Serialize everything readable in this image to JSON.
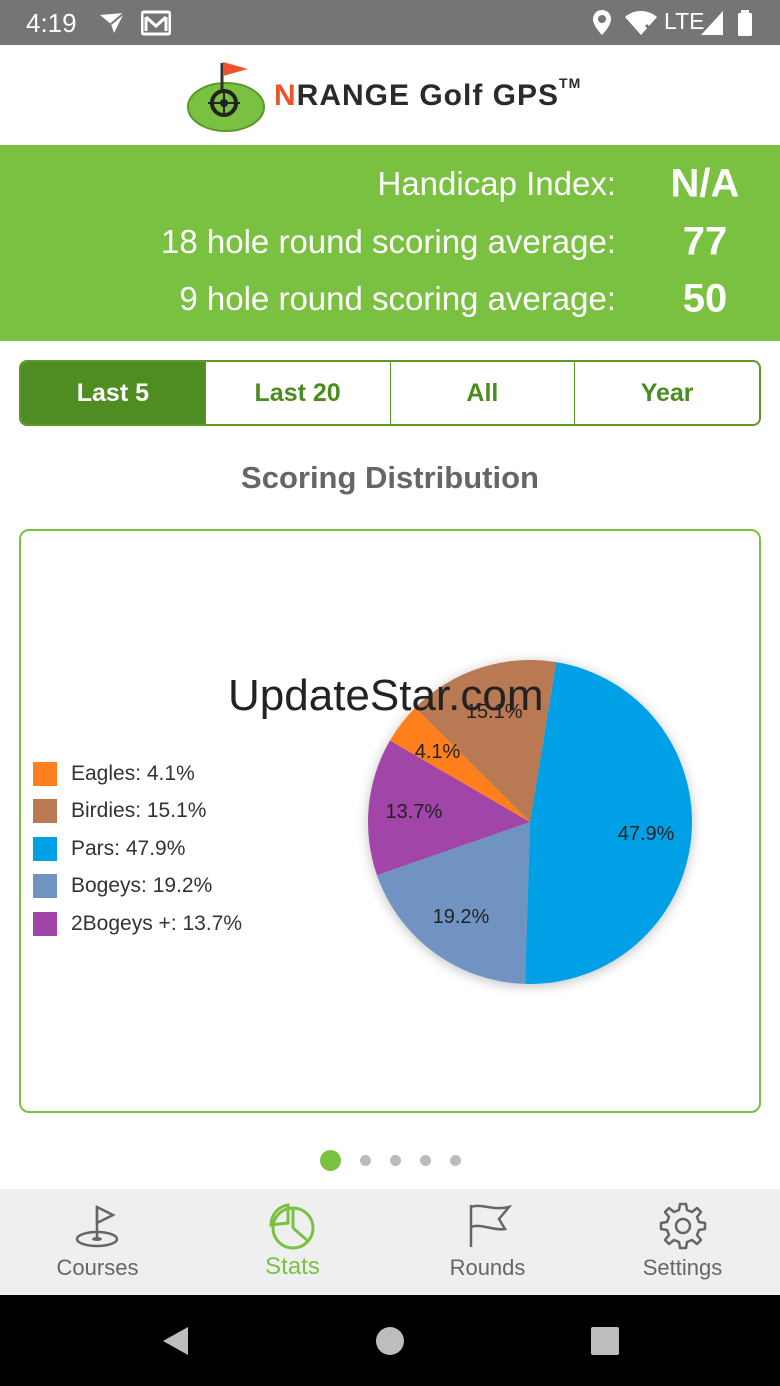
{
  "status_bar": {
    "time": "4:19",
    "network": "LTE",
    "icons": [
      "airplane-arrow-icon",
      "gmail-icon",
      "location-icon",
      "wifi-icon",
      "signal-icon",
      "battery-icon"
    ]
  },
  "header": {
    "logo_n": "N",
    "logo_text": "RANGE Golf GPS",
    "logo_tm": "TM"
  },
  "stats": {
    "handicap_label": "Handicap Index:",
    "handicap_value": "N/A",
    "avg18_label": "18 hole round scoring average:",
    "avg18_value": "77",
    "avg9_label": "9 hole round scoring average:",
    "avg9_value": "50"
  },
  "filters": {
    "tabs": [
      "Last 5",
      "Last 20",
      "All",
      "Year"
    ],
    "selected": "Last 5"
  },
  "section_title": "Scoring Distribution",
  "chart_data": {
    "type": "pie",
    "title": "Scoring Distribution",
    "legend_position": "left",
    "slices": [
      {
        "name": "Pars",
        "value": 47.9,
        "label": "47.9%",
        "legend": "Pars: 47.9%",
        "color": "#00a0e6"
      },
      {
        "name": "Bogeys",
        "value": 19.2,
        "label": "19.2%",
        "legend": "Bogeys: 19.2%",
        "color": "#7093c2"
      },
      {
        "name": "2Bogeys +",
        "value": 13.7,
        "label": "13.7%",
        "legend": "2Bogeys +: 13.7%",
        "color": "#a144a8"
      },
      {
        "name": "Eagles",
        "value": 4.1,
        "label": "4.1%",
        "legend": "Eagles: 4.1%",
        "color": "#ff7f1e"
      },
      {
        "name": "Birdies",
        "value": 15.1,
        "label": "15.1%",
        "legend": "Birdies: 15.1%",
        "color": "#b97953"
      }
    ],
    "legend_order": [
      "Eagles",
      "Birdies",
      "Pars",
      "Bogeys",
      "2Bogeys +"
    ]
  },
  "watermark": "UpdateStar.com",
  "pager": {
    "count": 5,
    "active": 1
  },
  "tabbar": {
    "items": [
      {
        "label": "Courses",
        "icon": "golf-hole-icon"
      },
      {
        "label": "Stats",
        "icon": "pie-chart-icon"
      },
      {
        "label": "Rounds",
        "icon": "flag-icon"
      },
      {
        "label": "Settings",
        "icon": "gear-icon"
      }
    ],
    "active": "Stats"
  },
  "colors": {
    "accent": "#7ac142",
    "accent_dark": "#4f8d23",
    "status_bar": "#757575"
  }
}
